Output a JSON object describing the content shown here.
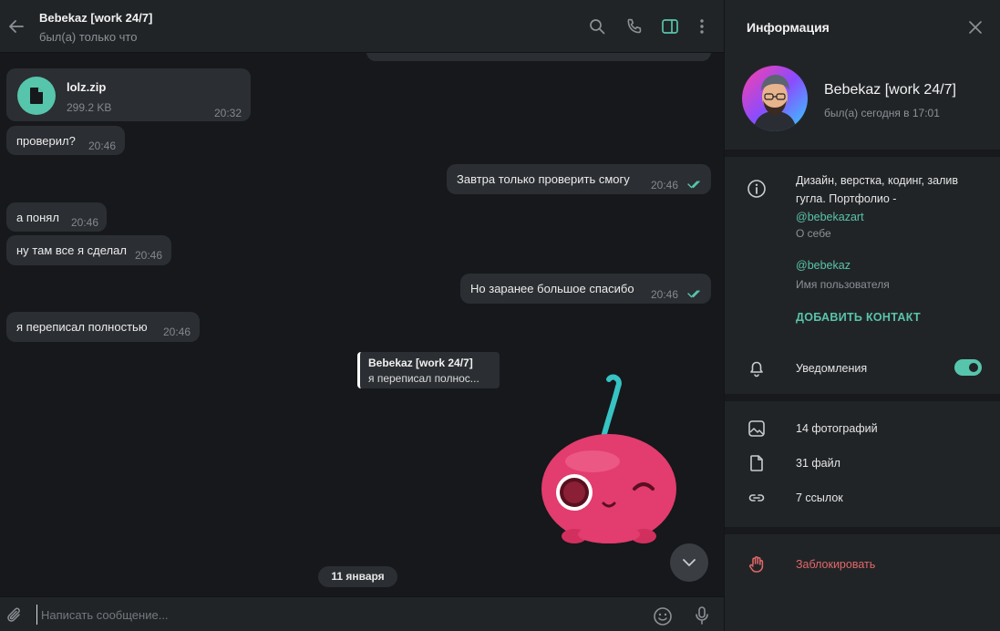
{
  "header": {
    "title": "Bebekaz [work 24/7]",
    "status": "был(а) только что"
  },
  "messages": [
    {
      "type": "file",
      "direction": "in",
      "file_name": "lolz.zip",
      "file_size": "299.2 KB",
      "time": "20:32"
    },
    {
      "type": "text",
      "direction": "in",
      "text": "проверил?",
      "time": "20:46"
    },
    {
      "type": "text",
      "direction": "out",
      "text": "Завтра только проверить смогу",
      "time": "20:46",
      "read": true
    },
    {
      "type": "text",
      "direction": "in",
      "text": "а понял",
      "time": "20:46"
    },
    {
      "type": "text",
      "direction": "in",
      "text": "ну там все я сделал",
      "time": "20:46"
    },
    {
      "type": "text",
      "direction": "out",
      "text": "Но заранее большое спасибо",
      "time": "20:46",
      "read": true
    },
    {
      "type": "text",
      "direction": "in",
      "text": "я переписал полностью",
      "time": "20:46"
    }
  ],
  "reply": {
    "author": "Bebekaz [work 24/7]",
    "text": "я переписал полнос..."
  },
  "date_separator": "11 января",
  "composer": {
    "placeholder": "Написать сообщение..."
  },
  "info": {
    "title": "Информация",
    "name": "Bebekaz [work 24/7]",
    "status": "был(а) сегодня в 17:01",
    "bio_text": "Дизайн, верстка, кодинг, залив гугла. Портфолио -",
    "bio_link": "@bebekazart",
    "bio_caption": "О себе",
    "username": "@bebekaz",
    "username_caption": "Имя пользователя",
    "add_contact": "ДОБАВИТЬ КОНТАКТ",
    "notifications": "Уведомления",
    "notifications_on": true,
    "photos": "14 фотографий",
    "files": "31 файл",
    "links": "7 ссылок",
    "block": "Заблокировать"
  },
  "colors": {
    "accent": "#56c5ac",
    "danger": "#e2686a",
    "bubble": "#2b2e32",
    "panel": "#212427"
  }
}
